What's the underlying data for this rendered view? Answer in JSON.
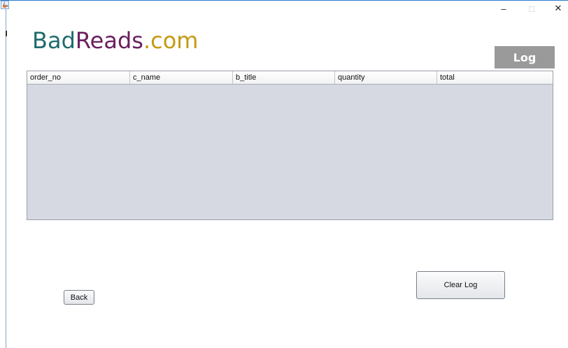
{
  "window": {
    "minimize_glyph": "–",
    "maximize_glyph": "□",
    "close_glyph": "✕",
    "icon": "java-cup-icon"
  },
  "brand": {
    "part1": "Bad",
    "part2": "Reads",
    "part3": ".com",
    "colors": {
      "part1": "#1e6b6c",
      "part2": "#6a1f5e",
      "part3": "#c39a13"
    }
  },
  "badge": {
    "label": "Log",
    "color": "#9a9a9a"
  },
  "table": {
    "columns": [
      "order_no",
      "c_name",
      "b_title",
      "quantity",
      "total"
    ],
    "rows": []
  },
  "buttons": {
    "clear_log": "Clear Log",
    "back": "Back"
  }
}
